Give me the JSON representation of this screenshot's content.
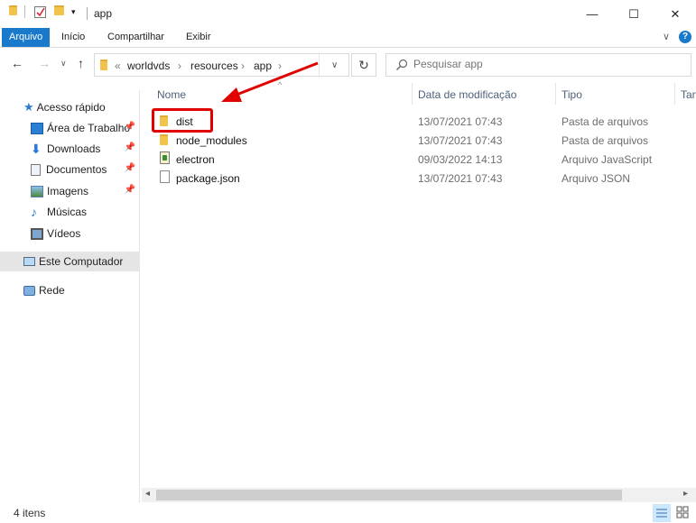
{
  "window": {
    "title": "app",
    "minimize_glyph": "—",
    "maximize_glyph": "☐",
    "close_glyph": "✕"
  },
  "ribbon": {
    "tabs": [
      "Arquivo",
      "Início",
      "Compartilhar",
      "Exibir"
    ],
    "collapse_glyph": "∨",
    "help_glyph": "?"
  },
  "nav": {
    "back_glyph": "←",
    "forward_glyph": "→",
    "recent_glyph": "∨",
    "up_glyph": "↑",
    "breadcrumb_prefix": "«",
    "breadcrumb": [
      "worldvds",
      "resources",
      "app"
    ],
    "separator_glyph": "›",
    "dropdown_glyph": "∨",
    "refresh_glyph": "↻",
    "search_placeholder": "Pesquisar app"
  },
  "sidebar": {
    "items": [
      {
        "label": "Acesso rápido",
        "icon": "star-icon"
      },
      {
        "label": "Área de Trabalho",
        "icon": "desktop-icon",
        "pinned": true
      },
      {
        "label": "Downloads",
        "icon": "download-icon",
        "pinned": true
      },
      {
        "label": "Documentos",
        "icon": "documents-icon",
        "pinned": true
      },
      {
        "label": "Imagens",
        "icon": "pictures-icon",
        "pinned": true
      },
      {
        "label": "Músicas",
        "icon": "music-icon"
      },
      {
        "label": "Vídeos",
        "icon": "videos-icon"
      },
      {
        "label": "Este Computador",
        "icon": "computer-icon",
        "selected": true
      },
      {
        "label": "Rede",
        "icon": "network-icon"
      }
    ],
    "pin_glyph": "📌"
  },
  "columns": {
    "name": "Nome",
    "date": "Data de modificação",
    "type": "Tipo",
    "size": "Tan"
  },
  "files": [
    {
      "name": "dist",
      "date": "13/07/2021 07:43",
      "type": "Pasta de arquivos",
      "icon": "folder-icon"
    },
    {
      "name": "node_modules",
      "date": "13/07/2021 07:43",
      "type": "Pasta de arquivos",
      "icon": "folder-icon"
    },
    {
      "name": "electron",
      "date": "09/03/2022 14:13",
      "type": "Arquivo JavaScript",
      "icon": "javascript-file-icon"
    },
    {
      "name": "package.json",
      "date": "13/07/2021 07:43",
      "type": "Arquivo JSON",
      "icon": "file-icon"
    }
  ],
  "status": {
    "item_count": "4 itens"
  },
  "annotation": {
    "highlight_color": "#e00000",
    "target": "dist"
  },
  "colors": {
    "file_tab": "#1979ca",
    "header_text": "#4c607a",
    "selected_nav": "#e5e5e5"
  }
}
